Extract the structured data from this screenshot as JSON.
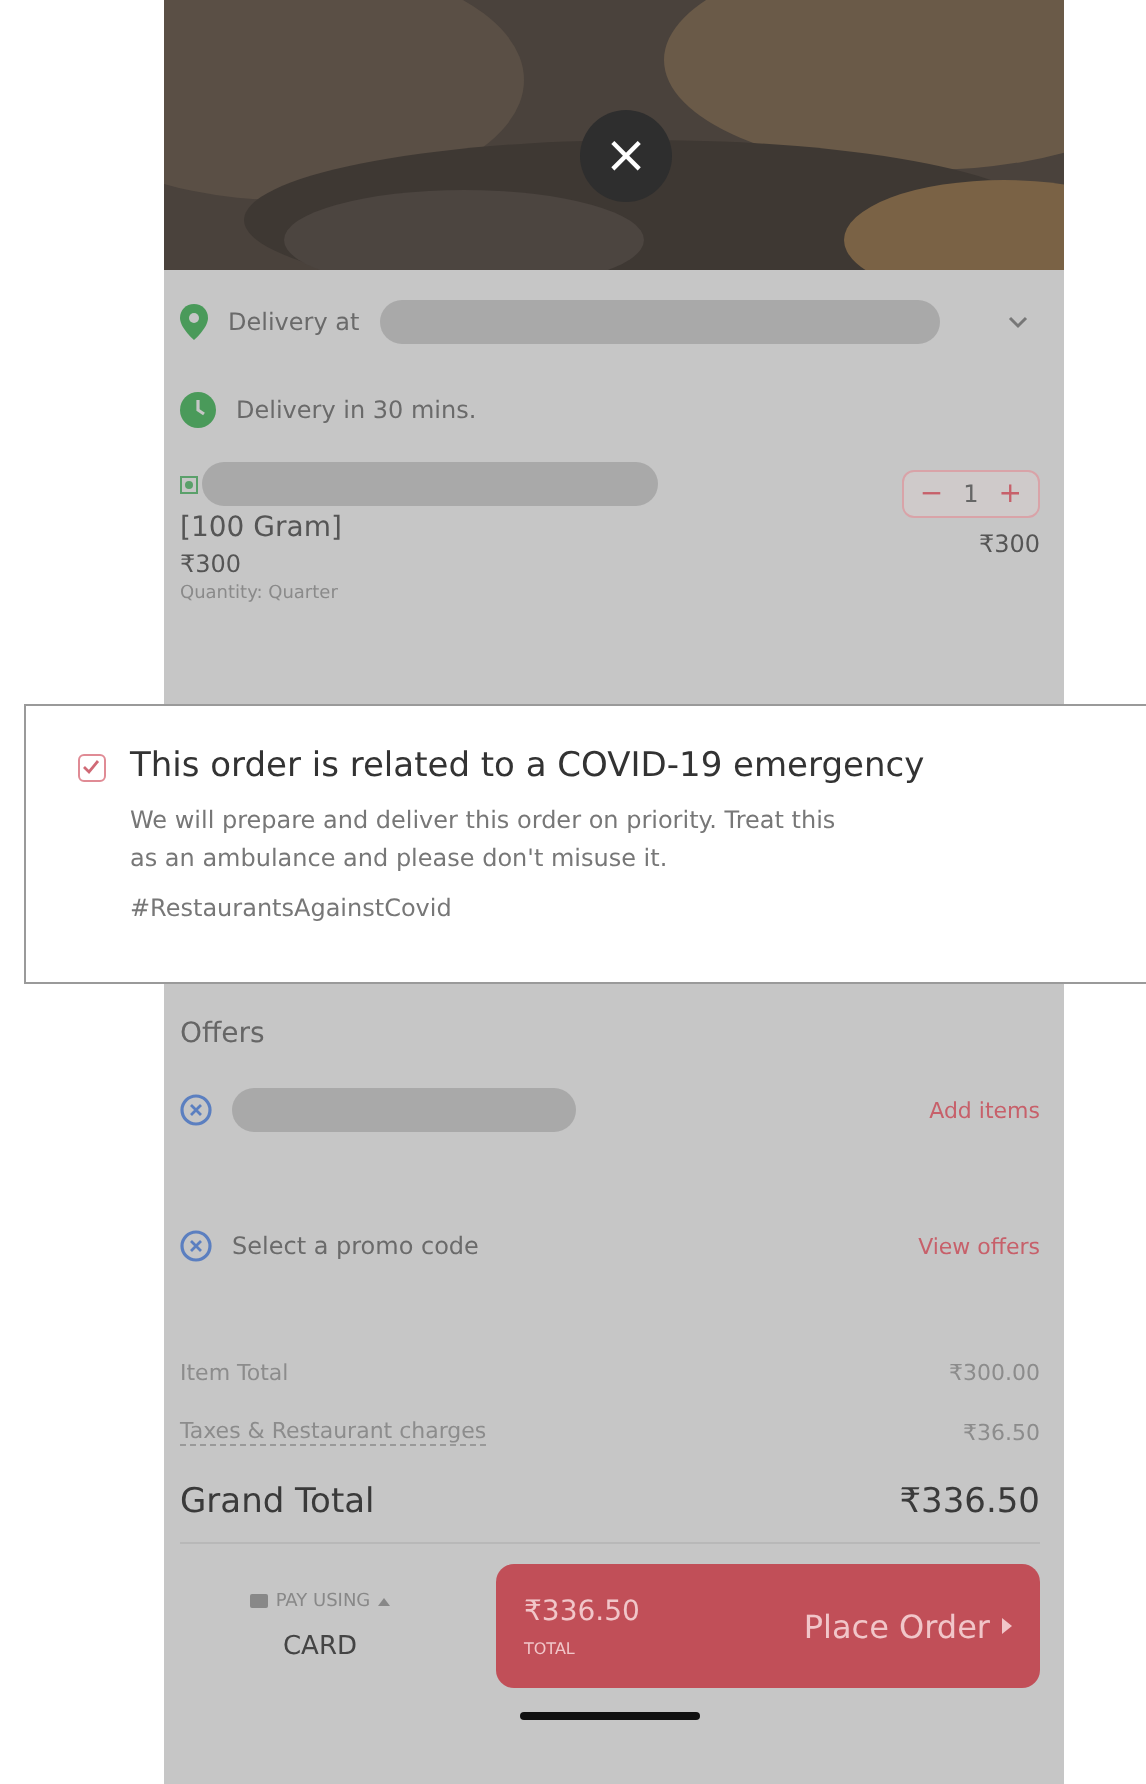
{
  "close_button": {
    "label": "×"
  },
  "delivery": {
    "address_label": "Delivery at",
    "time": "Delivery in 30 mins."
  },
  "item": {
    "variant": "[100 Gram]",
    "price": "₹300",
    "quantity": "Quantity: Quarter",
    "count": "1",
    "minus": "−",
    "plus": "+",
    "total": "₹300"
  },
  "emergency": {
    "checked": true,
    "title": "This order is related to a COVID-19 emergency",
    "description": "We will prepare and deliver this order on priority. Treat this as an ambulance and please don't misuse it.",
    "hashtag": "#RestaurantsAgainstCovid"
  },
  "offers": {
    "title": "Offers",
    "rows": [
      {
        "kind": "redacted",
        "action": "Add items"
      },
      {
        "kind": "text",
        "label": "Select a promo code",
        "action": "View offers"
      }
    ]
  },
  "bill": [
    {
      "label": "Item Total",
      "value": "₹300.00",
      "dashed": false
    },
    {
      "label": "Taxes & Restaurant charges",
      "value": "₹36.50",
      "dashed": true
    }
  ],
  "grand_total": {
    "label": "Grand Total",
    "value": "₹336.50"
  },
  "footer": {
    "pay_using": "PAY USING",
    "method": "CARD",
    "amount": "₹336.50",
    "amount_label": "TOTAL",
    "action": "Place Order"
  }
}
